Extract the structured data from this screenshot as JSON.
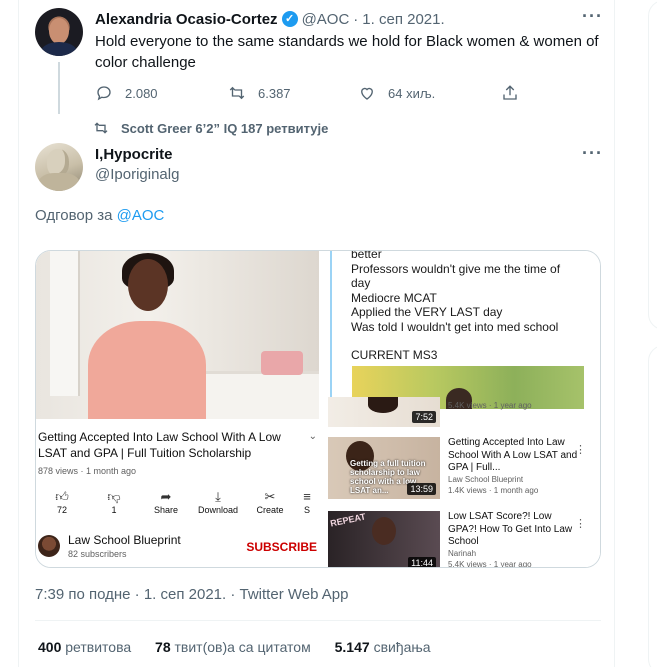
{
  "parent_tweet": {
    "author_name": "Alexandria Ocasio-Cortez",
    "handle": "@AOC",
    "date": "1. сеп 2021.",
    "text": "Hold everyone to the same standards we hold for Black women & women of color challenge",
    "replies": "2.080",
    "retweets": "6.387",
    "likes": "64 хиљ."
  },
  "retweeted_by": "Scott Greer 6’2” IQ 187 ретвитује",
  "tweet": {
    "author_name": "I,Hypocrite",
    "handle": "@Iporiginalg",
    "reply_prefix": "Одговор за",
    "reply_mention": "@AOC",
    "timestamp": "7:39 по подне · 1. сеп 2021. · Twitter Web App",
    "stats": {
      "retweets_count": "400",
      "retweets_label": "ретвитова",
      "quotes_count": "78",
      "quotes_label": "твит(ов)а са цитатом",
      "likes_count": "5.147",
      "likes_label": "свиђања"
    }
  },
  "media": {
    "video": {
      "title": "Getting Accepted Into Law School With A Low LSAT and GPA | Full Tuition Scholarship",
      "meta": "878 views · 1 month ago",
      "actions": [
        {
          "icon": "thumbs-up-icon",
          "label": "72"
        },
        {
          "icon": "thumbs-down-icon",
          "label": "1"
        },
        {
          "icon": "share-icon",
          "label": "Share"
        },
        {
          "icon": "download-icon",
          "label": "Download"
        },
        {
          "icon": "create-icon",
          "label": "Create"
        },
        {
          "icon": "save-icon",
          "label": "S"
        }
      ],
      "channel_name": "Law School Blueprint",
      "channel_subs": "82 subscribers",
      "subscribe_label": "SUBSCRIBE"
    },
    "notes": [
      "better",
      "Professors wouldn't give me the time of",
      "day",
      "Mediocre MCAT",
      "Applied the VERY LAST day",
      "Was told I wouldn't get into med school"
    ],
    "notes_heading": "CURRENT MS3",
    "recommendations": [
      {
        "duration": "7:52",
        "title": "",
        "channel": "",
        "meta": "5.4K views · 1 year ago"
      },
      {
        "duration": "13:59",
        "title": "Getting Accepted Into Law School With A Low LSAT and GPA | Full...",
        "channel": "Law School Blueprint",
        "meta": "1.4K views · 1 month ago",
        "thumb_text": "Getting a full tuition scholarship to law school with a low LSAT an..."
      },
      {
        "duration": "11:44",
        "title": "Low LSAT Score?! Low GPA?! How To Get Into Law School",
        "channel": "Narinah",
        "meta": "5.4K views · 1 year ago",
        "thumb_text": "REPEAT"
      }
    ]
  },
  "colors": {
    "accent": "#1d9bf0",
    "muted": "#536471",
    "subscribe": "#cc0000"
  }
}
